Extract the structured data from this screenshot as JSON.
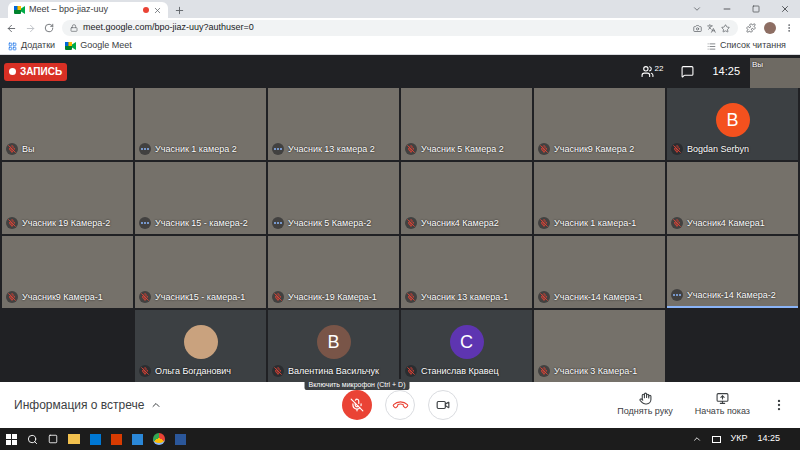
{
  "browser": {
    "tab": {
      "title": "Meet – bpo-jiaz-uuy",
      "selected": true,
      "recording": true
    },
    "url": "meet.google.com/bpo-jiaz-uuy?authuser=0",
    "bookmarks": [
      "Додатки",
      "Google Meet"
    ],
    "reading_list": "Список читання"
  },
  "meet": {
    "recording_label": "ЗАПИСЬ",
    "participants_count": "22",
    "time": "14:25",
    "self_view_label": "Вы",
    "rows": [
      [
        {
          "name": "Вы",
          "kind": "video",
          "muted": true,
          "highlighted": false
        },
        {
          "name": "Учасник 1 камера 2",
          "kind": "video",
          "muted": false,
          "highlighted": false
        },
        {
          "name": "Учасник 13 камера 2",
          "kind": "video",
          "muted": false,
          "highlighted": false
        },
        {
          "name": "Учасник 5 Камера 2",
          "kind": "video",
          "muted": true,
          "highlighted": false
        },
        {
          "name": "Учасник9 Камера 2",
          "kind": "video",
          "muted": true,
          "highlighted": false
        },
        {
          "name": "Bogdan Serbyn",
          "kind": "avatar",
          "initial": "B",
          "color": "#f4511e",
          "muted": true,
          "highlighted": false
        }
      ],
      [
        {
          "name": "Учасник 19 Камера-2",
          "kind": "video",
          "muted": true,
          "highlighted": false
        },
        {
          "name": "Учасник 15 - камера-2",
          "kind": "video",
          "muted": false,
          "highlighted": false
        },
        {
          "name": "Учасник 5 Камера-2",
          "kind": "video",
          "muted": false,
          "highlighted": false
        },
        {
          "name": "Учасник4 Камера2",
          "kind": "video",
          "muted": true,
          "highlighted": false
        },
        {
          "name": "Учасник 1 камера-1",
          "kind": "video",
          "muted": true,
          "highlighted": false
        },
        {
          "name": "Учасник4 Камера1",
          "kind": "video",
          "muted": true,
          "highlighted": false
        }
      ],
      [
        {
          "name": "Учасник9 Камера-1",
          "kind": "video",
          "muted": true,
          "highlighted": false
        },
        {
          "name": "Учасник15 - камера-1",
          "kind": "video",
          "muted": true,
          "highlighted": false
        },
        {
          "name": "Учасник-19 Камера-1",
          "kind": "video",
          "muted": true,
          "highlighted": false
        },
        {
          "name": "Учасник 13 камера-1",
          "kind": "video",
          "muted": true,
          "highlighted": false
        },
        {
          "name": "Учасник-14 Камера-1",
          "kind": "video",
          "muted": true,
          "highlighted": false
        },
        {
          "name": "Учасник-14 Камера-2",
          "kind": "video",
          "muted": false,
          "highlighted": true
        }
      ],
      [
        {
          "name": "Ольга Богданович",
          "kind": "photo",
          "muted": true,
          "highlighted": false
        },
        {
          "name": "Валентина Васильчук",
          "kind": "avatar",
          "initial": "В",
          "color": "#795548",
          "muted": true,
          "highlighted": false
        },
        {
          "name": "Станислав Кравец",
          "kind": "avatar",
          "initial": "С",
          "color": "#5e35b1",
          "muted": true,
          "highlighted": false
        },
        {
          "name": "Учасник 3 Камера-1",
          "kind": "video",
          "muted": true,
          "highlighted": false
        }
      ]
    ]
  },
  "tooltip": "Включить микрофон (Ctrl + D)",
  "controls": {
    "meeting_info": "Информация о встрече",
    "mic_muted": true,
    "camera_off": false,
    "raise_hand": "Поднять руку",
    "present": "Начать показ"
  },
  "taskbar": {
    "language": "УКР",
    "time": "14:25"
  }
}
